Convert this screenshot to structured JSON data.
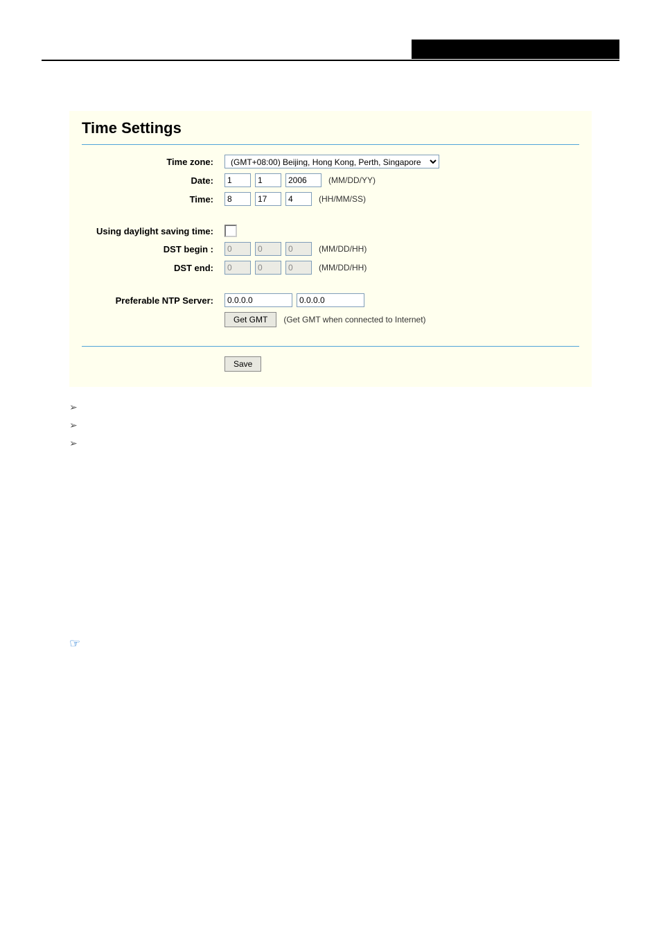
{
  "screenshot": {
    "title": "Time Settings",
    "labels": {
      "time_zone": "Time zone:",
      "date": "Date:",
      "time": "Time:",
      "dst_enable": "Using daylight saving time:",
      "dst_begin": "DST begin :",
      "dst_end": "DST end:",
      "ntp": "Preferable NTP Server:"
    },
    "values": {
      "tz_selected": "(GMT+08:00) Beijing, Hong Kong, Perth, Singapore",
      "date_mm": "1",
      "date_dd": "1",
      "date_yy": "2006",
      "time_hh": "8",
      "time_mm": "17",
      "time_ss": "4",
      "dst_begin_mm": "0",
      "dst_begin_dd": "0",
      "dst_begin_hh": "0",
      "dst_end_mm": "0",
      "dst_end_dd": "0",
      "dst_end_hh": "0",
      "ntp1": "0.0.0.0",
      "ntp2": "0.0.0.0"
    },
    "hints": {
      "date": "(MM/DD/YY)",
      "time": "(HH/MM/SS)",
      "dst": "(MM/DD/HH)",
      "get_gmt": "(Get GMT when connected to Internet)"
    },
    "buttons": {
      "get_gmt": "Get GMT",
      "save": "Save"
    }
  }
}
